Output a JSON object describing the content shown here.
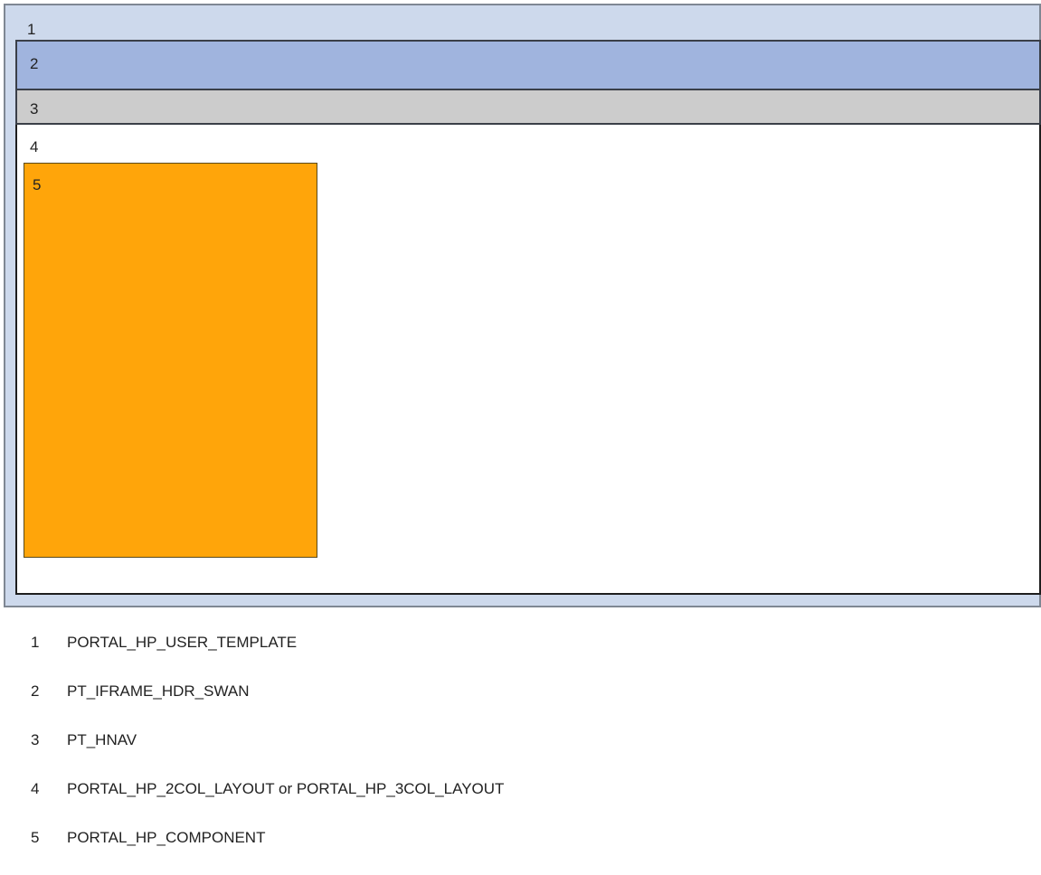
{
  "regions": [
    {
      "number": "1",
      "color": "#cdd9ec"
    },
    {
      "number": "2",
      "color": "#a0b4de"
    },
    {
      "number": "3",
      "color": "#cccccc"
    },
    {
      "number": "4",
      "color": "#ffffff"
    },
    {
      "number": "5",
      "color": "#ffa50a"
    }
  ],
  "legend": [
    {
      "number": "1",
      "text": "PORTAL_HP_USER_TEMPLATE"
    },
    {
      "number": "2",
      "text": "PT_IFRAME_HDR_SWAN"
    },
    {
      "number": "3",
      "text": "PT_HNAV"
    },
    {
      "number": "4",
      "text": "PORTAL_HP_2COL_LAYOUT or PORTAL_HP_3COL_LAYOUT"
    },
    {
      "number": "5",
      "text": "PORTAL_HP_COMPONENT"
    }
  ]
}
